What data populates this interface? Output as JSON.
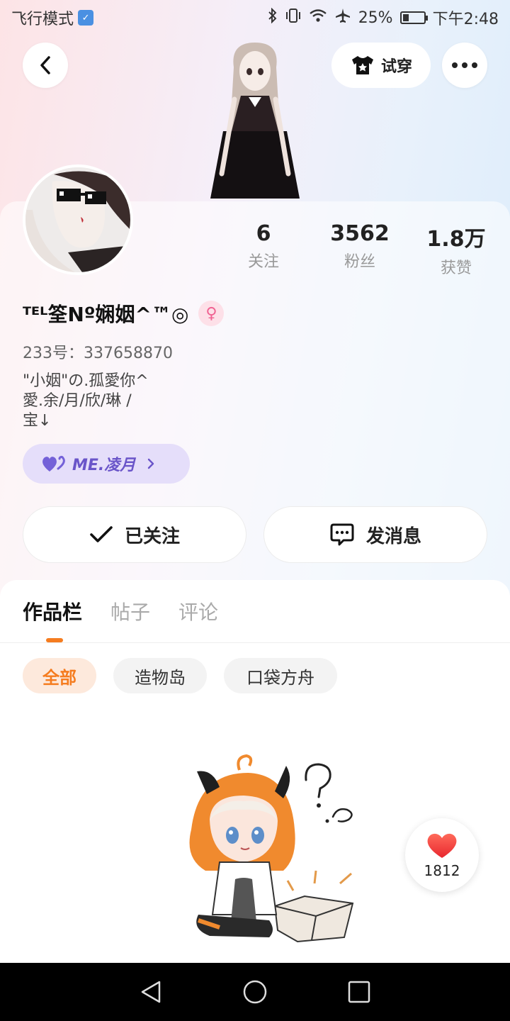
{
  "status_bar": {
    "mode": "飞行模式",
    "battery": "25%",
    "battery_level": 0.25,
    "time": "下午2:48"
  },
  "header": {
    "tryon_label": "试穿"
  },
  "profile": {
    "stats": [
      {
        "value": "6",
        "label": "关注"
      },
      {
        "value": "3562",
        "label": "粉丝"
      },
      {
        "value": "1.8万",
        "label": "获赞"
      }
    ],
    "username": "ᵀᴱᴸ筌Nº娴姻^™◎",
    "uid": "233号：337658870",
    "bio_lines": [
      "\"小姻\"の.孤愛你^",
      "愛.余/月/欣/琳 /",
      "宝↓"
    ],
    "tag": "ME.凌月"
  },
  "actions": {
    "follow_label": "已关注",
    "message_label": "发消息"
  },
  "tabs": [
    "作品栏",
    "帖子",
    "评论"
  ],
  "filters": [
    "全部",
    "造物岛",
    "口袋方舟"
  ],
  "like_fab": {
    "count": "1812"
  },
  "colors": {
    "accent": "#f57c1f",
    "tag_purple": "#6a55c9",
    "gender_pink": "#f06292"
  }
}
